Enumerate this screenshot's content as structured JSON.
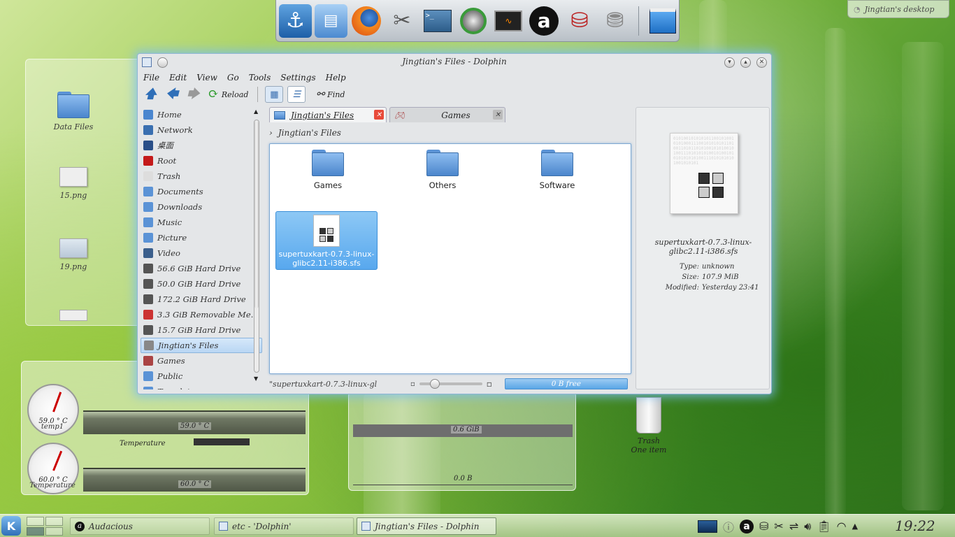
{
  "desktop": {
    "activity_label": "Jingtian's desktop",
    "folderview_items": [
      {
        "label": "Data Files"
      },
      {
        "label": "15.png"
      },
      {
        "label": "19.png"
      }
    ],
    "trash": {
      "label": "Trash",
      "sublabel": "One item"
    }
  },
  "dock": {
    "icons": [
      "anchor-icon",
      "file-cabinet-icon",
      "firefox-icon",
      "tools-icon",
      "terminal-icon",
      "wifi-disc-icon",
      "system-monitor-icon",
      "audacious-icon",
      "package-installer-icon",
      "hard-disk-icon",
      "desktop-window-icon"
    ]
  },
  "sensor_widget": {
    "gauges": [
      {
        "value": "59.0 ° C",
        "label": "temp1"
      },
      {
        "value": "60.0 ° C",
        "label": "Temperature"
      }
    ],
    "graphs": [
      {
        "value": "59.0 ° C"
      },
      {
        "value": "60.0 ° C"
      }
    ],
    "temperature_label": "Temperature"
  },
  "memory_widget": {
    "value1": "0.6 GiB",
    "value2": "0.0 B"
  },
  "window": {
    "title": "Jingtian's Files - Dolphin",
    "menu": [
      "File",
      "Edit",
      "View",
      "Go",
      "Tools",
      "Settings",
      "Help"
    ],
    "toolbar": {
      "reload": "Reload",
      "find": "Find"
    },
    "places": [
      {
        "label": "Home",
        "color": "#4a86cf"
      },
      {
        "label": "Network",
        "color": "#3a6fb0"
      },
      {
        "label": "桌面",
        "color": "#2a4f88"
      },
      {
        "label": "Root",
        "color": "#c41a1a"
      },
      {
        "label": "Trash",
        "color": "#dddddd"
      },
      {
        "label": "Documents",
        "color": "#5b93d6"
      },
      {
        "label": "Downloads",
        "color": "#5b93d6"
      },
      {
        "label": "Music",
        "color": "#5b93d6"
      },
      {
        "label": "Picture",
        "color": "#5b93d6"
      },
      {
        "label": "Video",
        "color": "#3b5f8c"
      },
      {
        "label": "56.6 GiB Hard Drive",
        "color": "#555555"
      },
      {
        "label": "50.0 GiB Hard Drive",
        "color": "#555555"
      },
      {
        "label": "172.2 GiB Hard Drive",
        "color": "#555555"
      },
      {
        "label": "3.3 GiB Removable Me…",
        "color": "#cc3333"
      },
      {
        "label": "15.7 GiB Hard Drive",
        "color": "#555555"
      },
      {
        "label": "Jingtian's Files",
        "color": "#888888"
      },
      {
        "label": "Games",
        "color": "#aa4444"
      },
      {
        "label": "Public",
        "color": "#5b93d6"
      },
      {
        "label": "Templates",
        "color": "#5b93d6"
      }
    ],
    "tabs": [
      {
        "label": "Jingtian's Files"
      },
      {
        "label": "Games"
      }
    ],
    "breadcrumb": "Jingtian's Files",
    "files": [
      {
        "label": "Games"
      },
      {
        "label": "Others"
      },
      {
        "label": "Software"
      },
      {
        "label": "supertuxkart-0.7.3-linux-glibc2.11-i386.sfs"
      }
    ],
    "status": {
      "selection": "\"supertuxkart-0.7.3-linux-gl",
      "free": "0 B free",
      "zoom_level": 0.2
    },
    "info_panel": {
      "name": "supertuxkart-0.7.3-linux-glibc2.11-i386.sfs",
      "type_key": "Type:",
      "type_val": "unknown",
      "size_key": "Size:",
      "size_val": "107.9 MiB",
      "modified_key": "Modified:",
      "modified_val": "Yesterday 23:41"
    }
  },
  "panel": {
    "tasks": [
      {
        "label": "Audacious"
      },
      {
        "label": "etc - 'Dolphin'"
      },
      {
        "label": "Jingtian's Files - Dolphin"
      }
    ],
    "clock": "19:22"
  }
}
